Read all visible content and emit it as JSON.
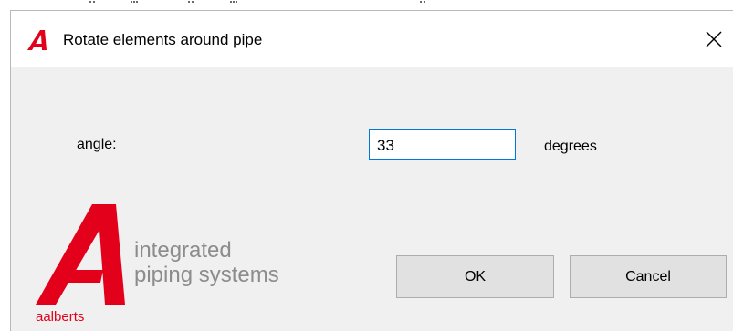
{
  "window": {
    "title": "Rotate elements around pipe",
    "title_icon": "aalberts-a-logo-icon",
    "close_icon": "close-icon"
  },
  "form": {
    "angle_label": "angle:",
    "angle_value": "33",
    "unit_label": "degrees"
  },
  "brand": {
    "logo_icon": "aalberts-logo-icon",
    "name": "aalberts",
    "tagline_line1": "integrated",
    "tagline_line2": "piping systems"
  },
  "buttons": {
    "ok_label": "OK",
    "cancel_label": "Cancel"
  },
  "colors": {
    "brand_red": "#e2001a",
    "tagline_gray": "#8c8c8c",
    "dialog_bg": "#f0f0f0",
    "input_border_focus": "#0078d7",
    "button_bg": "#e1e1e1"
  }
}
